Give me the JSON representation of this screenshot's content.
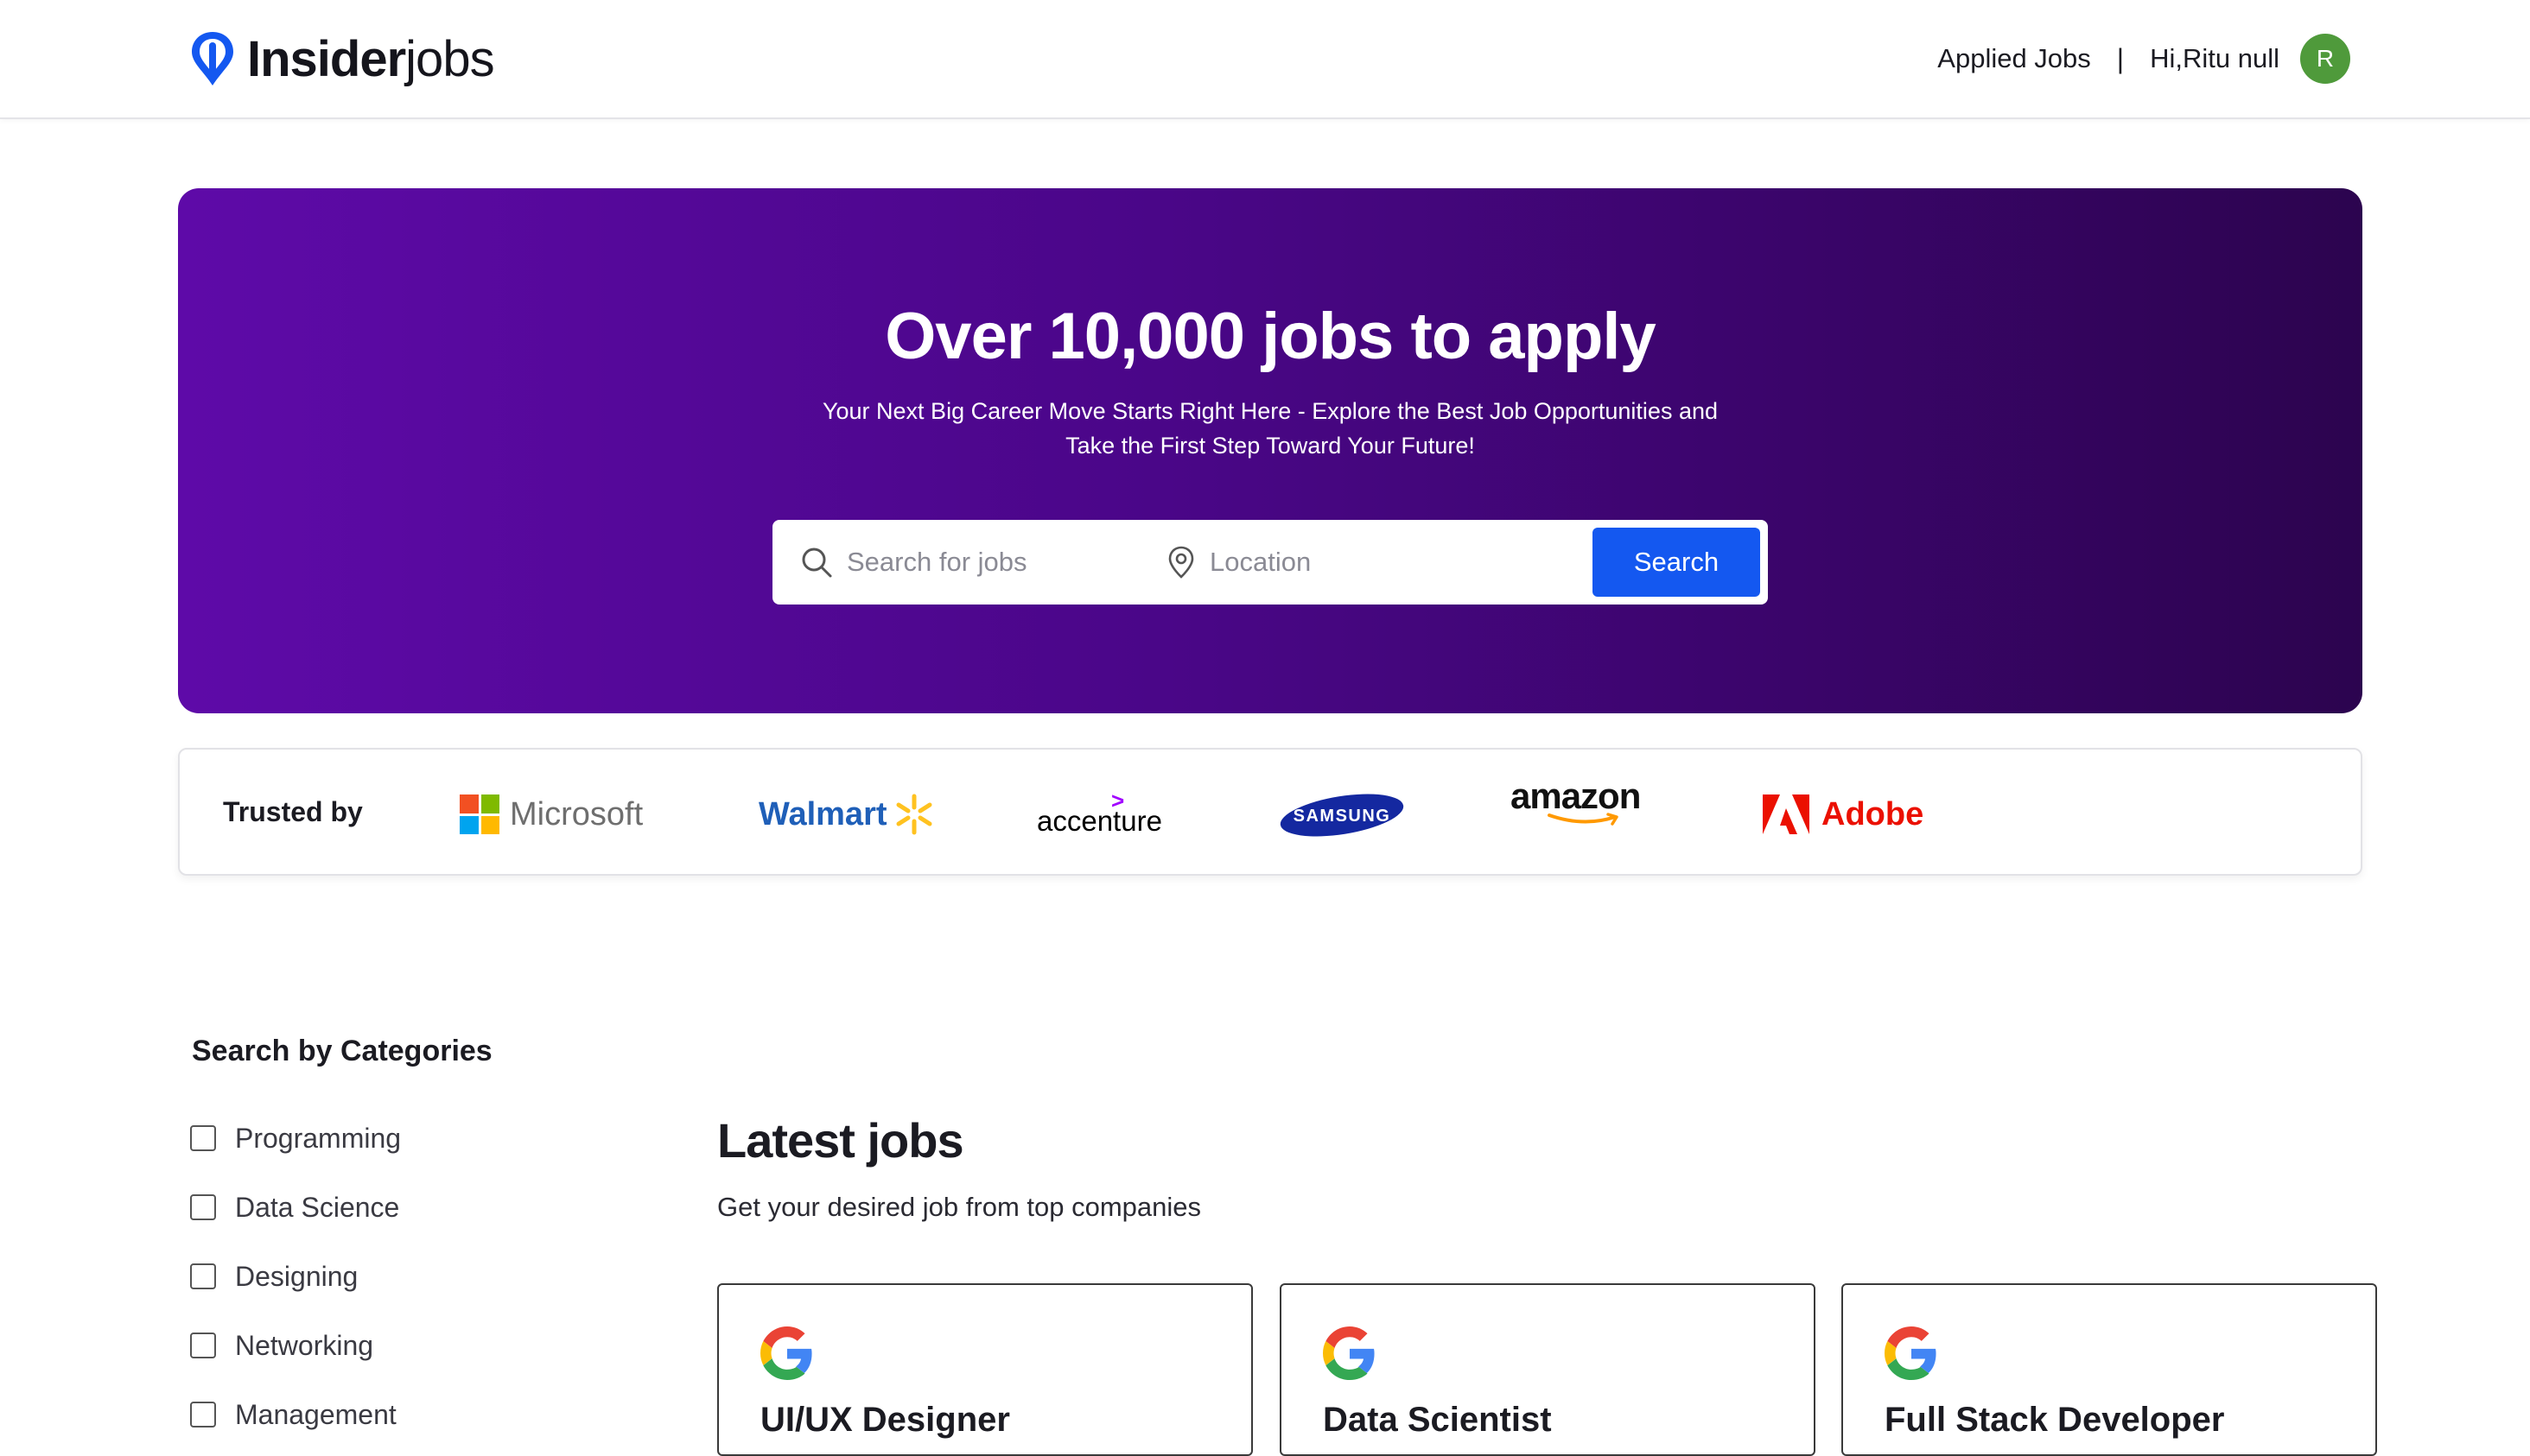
{
  "header": {
    "logo_bold": "Insider",
    "logo_light": "jobs",
    "applied_jobs_label": "Applied Jobs",
    "separator": "|",
    "greeting": "Hi,Ritu null",
    "avatar_initial": "R",
    "avatar_color": "#4f9a3b"
  },
  "hero": {
    "title": "Over 10,000 jobs to apply",
    "subtitle_line1": "Your Next Big Career Move Starts Right Here - Explore the Best Job Opportunities and",
    "subtitle_line2": "Take the First Step Toward Your Future!",
    "search_placeholder": "Search for jobs",
    "location_placeholder": "Location",
    "search_button": "Search",
    "accent_color": "#1458f0"
  },
  "trusted": {
    "label": "Trusted by",
    "brands": {
      "microsoft": "Microsoft",
      "walmart": "Walmart",
      "accenture": "accenture",
      "samsung": "SAMSUNG",
      "amazon": "amazon",
      "adobe": "Adobe"
    }
  },
  "categories": {
    "title": "Search by Categories",
    "items": [
      "Programming",
      "Data Science",
      "Designing",
      "Networking",
      "Management"
    ]
  },
  "latest": {
    "title": "Latest jobs",
    "subtitle": "Get your desired job from top companies",
    "jobs": [
      {
        "title": "UI/UX Designer",
        "company_icon": "google-icon"
      },
      {
        "title": "Data Scientist",
        "company_icon": "google-icon"
      },
      {
        "title": "Full Stack Developer",
        "company_icon": "google-icon"
      }
    ]
  }
}
